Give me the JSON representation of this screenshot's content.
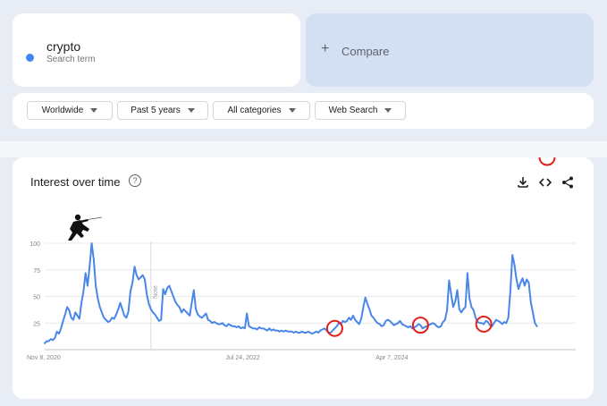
{
  "search": {
    "term": "crypto",
    "subtitle": "Search term",
    "dot_color": "#4285f4"
  },
  "compare": {
    "label": "Compare"
  },
  "filters": [
    {
      "label": "Worldwide"
    },
    {
      "label": "Past 5 years"
    },
    {
      "label": "All categories"
    },
    {
      "label": "Web Search"
    }
  ],
  "chart": {
    "title": "Interest over time",
    "note_label": "Note",
    "icons": [
      "help-icon",
      "download-icon",
      "embed-icon",
      "share-icon"
    ]
  },
  "chart_data": {
    "type": "line",
    "x_tick_labels": [
      "Nov 8, 2020",
      "Jul 24, 2022",
      "Apr 7, 2024"
    ],
    "ylim": [
      0,
      100
    ],
    "y_ticks": [
      25,
      50,
      75,
      100
    ],
    "grid": true,
    "line_color": "#4a86e8",
    "x_index_range": [
      0,
      260
    ],
    "values": [
      6,
      8,
      8,
      10,
      9,
      11,
      17,
      15,
      20,
      27,
      33,
      40,
      37,
      30,
      28,
      35,
      32,
      29,
      44,
      55,
      72,
      60,
      78,
      100,
      85,
      60,
      48,
      40,
      35,
      30,
      28,
      26,
      27,
      30,
      29,
      33,
      38,
      44,
      38,
      32,
      30,
      36,
      55,
      63,
      78,
      70,
      66,
      68,
      70,
      66,
      52,
      43,
      38,
      35,
      33,
      30,
      27,
      28,
      57,
      52,
      58,
      60,
      55,
      50,
      45,
      42,
      40,
      35,
      38,
      36,
      34,
      32,
      44,
      56,
      38,
      33,
      31,
      30,
      32,
      34,
      28,
      27,
      25,
      26,
      25,
      24,
      24,
      25,
      23,
      22,
      24,
      23,
      22,
      22,
      21,
      22,
      20,
      21,
      20,
      34,
      22,
      21,
      20,
      20,
      19,
      21,
      20,
      20,
      19,
      18,
      20,
      18,
      19,
      18,
      18,
      17,
      18,
      17,
      18,
      17,
      17,
      17,
      16,
      17,
      16,
      16,
      17,
      16,
      16,
      17,
      16,
      15,
      16,
      17,
      16,
      18,
      19,
      20,
      18,
      16,
      16,
      18,
      20,
      22,
      25,
      24,
      27,
      26,
      27,
      30,
      28,
      32,
      28,
      26,
      24,
      29,
      40,
      49,
      43,
      38,
      32,
      30,
      27,
      25,
      24,
      22,
      23,
      27,
      28,
      27,
      25,
      23,
      24,
      25,
      27,
      24,
      23,
      22,
      21,
      22,
      20,
      21,
      22,
      24,
      23,
      20,
      21,
      22,
      23,
      24,
      25,
      24,
      22,
      21,
      22,
      26,
      28,
      37,
      65,
      52,
      40,
      45,
      56,
      38,
      35,
      38,
      40,
      72,
      48,
      40,
      37,
      30,
      26,
      25,
      25,
      24,
      27,
      26,
      23,
      22,
      25,
      28,
      27,
      26,
      24,
      26,
      25,
      30,
      55,
      89,
      80,
      66,
      57,
      63,
      67,
      60,
      66,
      63,
      45,
      35,
      25,
      22
    ]
  },
  "annotations": {
    "circle_color": "#e0201b",
    "circled_indices": [
      142,
      184,
      215,
      246
    ]
  }
}
